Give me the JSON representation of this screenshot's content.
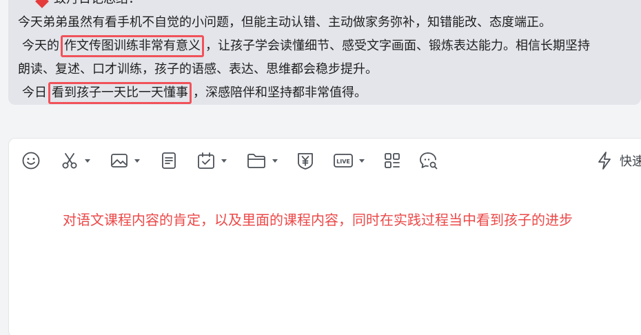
{
  "message": {
    "line0_text": "致丹日记总结：",
    "line1_text": "今天弟弟虽然有看手机不自觉的小问题，但能主动认错、主动做家务弥补，知错能改、态度端正。",
    "line2_pre": "今天的",
    "line2_highlight": "作文传图训练非常有意义",
    "line2_post": "，让孩子学会读懂细节、感受文字画面、锻炼表达能力。相信长期坚持",
    "line3_text": "朗读、复述、口才训练，孩子的语感、表达、思维都会稳步提升。",
    "line4_pre": "今日",
    "line4_highlight": "看到孩子一天比一天懂事",
    "line4_post": "，深感陪伴和坚持都非常值得。"
  },
  "toolbar": {
    "quick_label": "快速"
  },
  "composer": {
    "text": "对语文课程内容的肯定，以及里面的课程内容，同时在实践过程当中看到孩子的进步"
  },
  "colors": {
    "highlight_border": "#f1525a",
    "compose_text": "#ec4848",
    "bubble_bg": "#e3e5ea"
  }
}
